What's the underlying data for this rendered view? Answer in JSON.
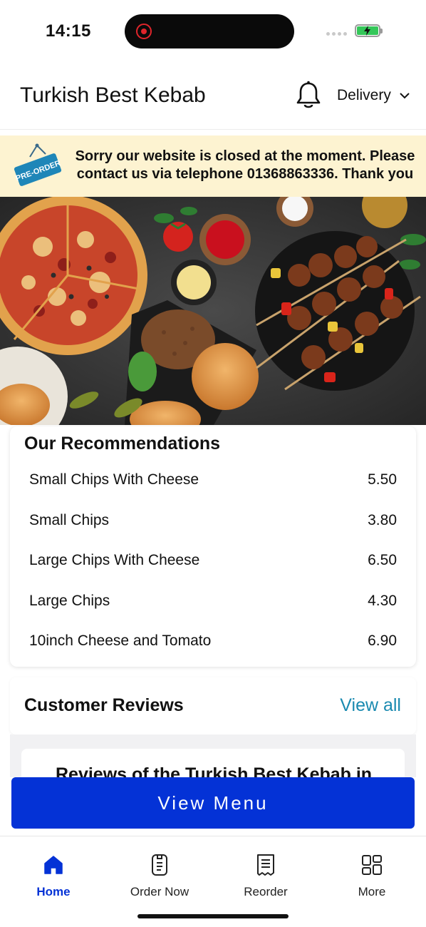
{
  "status_bar": {
    "time": "14:15",
    "battery_color": "#34c759",
    "recording_color": "#e0252b"
  },
  "header": {
    "title": "Turkish Best Kebab",
    "bell_icon": "bell-icon",
    "mode_label": "Delivery",
    "mode_icon": "chevron-down-icon"
  },
  "banner": {
    "badge_text": "PRE-ORDER",
    "message": "Sorry our website is closed at the moment. Please contact us via telephone 01368863336. Thank you",
    "background": "#fdf3d1"
  },
  "hero": {
    "image": "food-spread-photo"
  },
  "recommendations": {
    "title": "Our Recommendations",
    "items": [
      {
        "name": "Small Chips With Cheese",
        "price": "5.50"
      },
      {
        "name": "Small Chips",
        "price": "3.80"
      },
      {
        "name": "Large Chips With Cheese",
        "price": "6.50"
      },
      {
        "name": "Large Chips",
        "price": "4.30"
      },
      {
        "name": "10inch Cheese and Tomato",
        "price": "6.90"
      }
    ]
  },
  "reviews": {
    "title": "Customer Reviews",
    "view_all": "View all",
    "peek_text": "Reviews of the Turkish Best Kebab in"
  },
  "view_menu_button": {
    "label": "View Menu",
    "color": "#0432d6"
  },
  "tab_bar": {
    "active_color": "#0432d6",
    "tabs": [
      {
        "label": "Home",
        "icon": "home-icon",
        "active": true
      },
      {
        "label": "Order Now",
        "icon": "order-icon",
        "active": false
      },
      {
        "label": "Reorder",
        "icon": "receipt-icon",
        "active": false
      },
      {
        "label": "More",
        "icon": "grid-icon",
        "active": false
      }
    ]
  }
}
